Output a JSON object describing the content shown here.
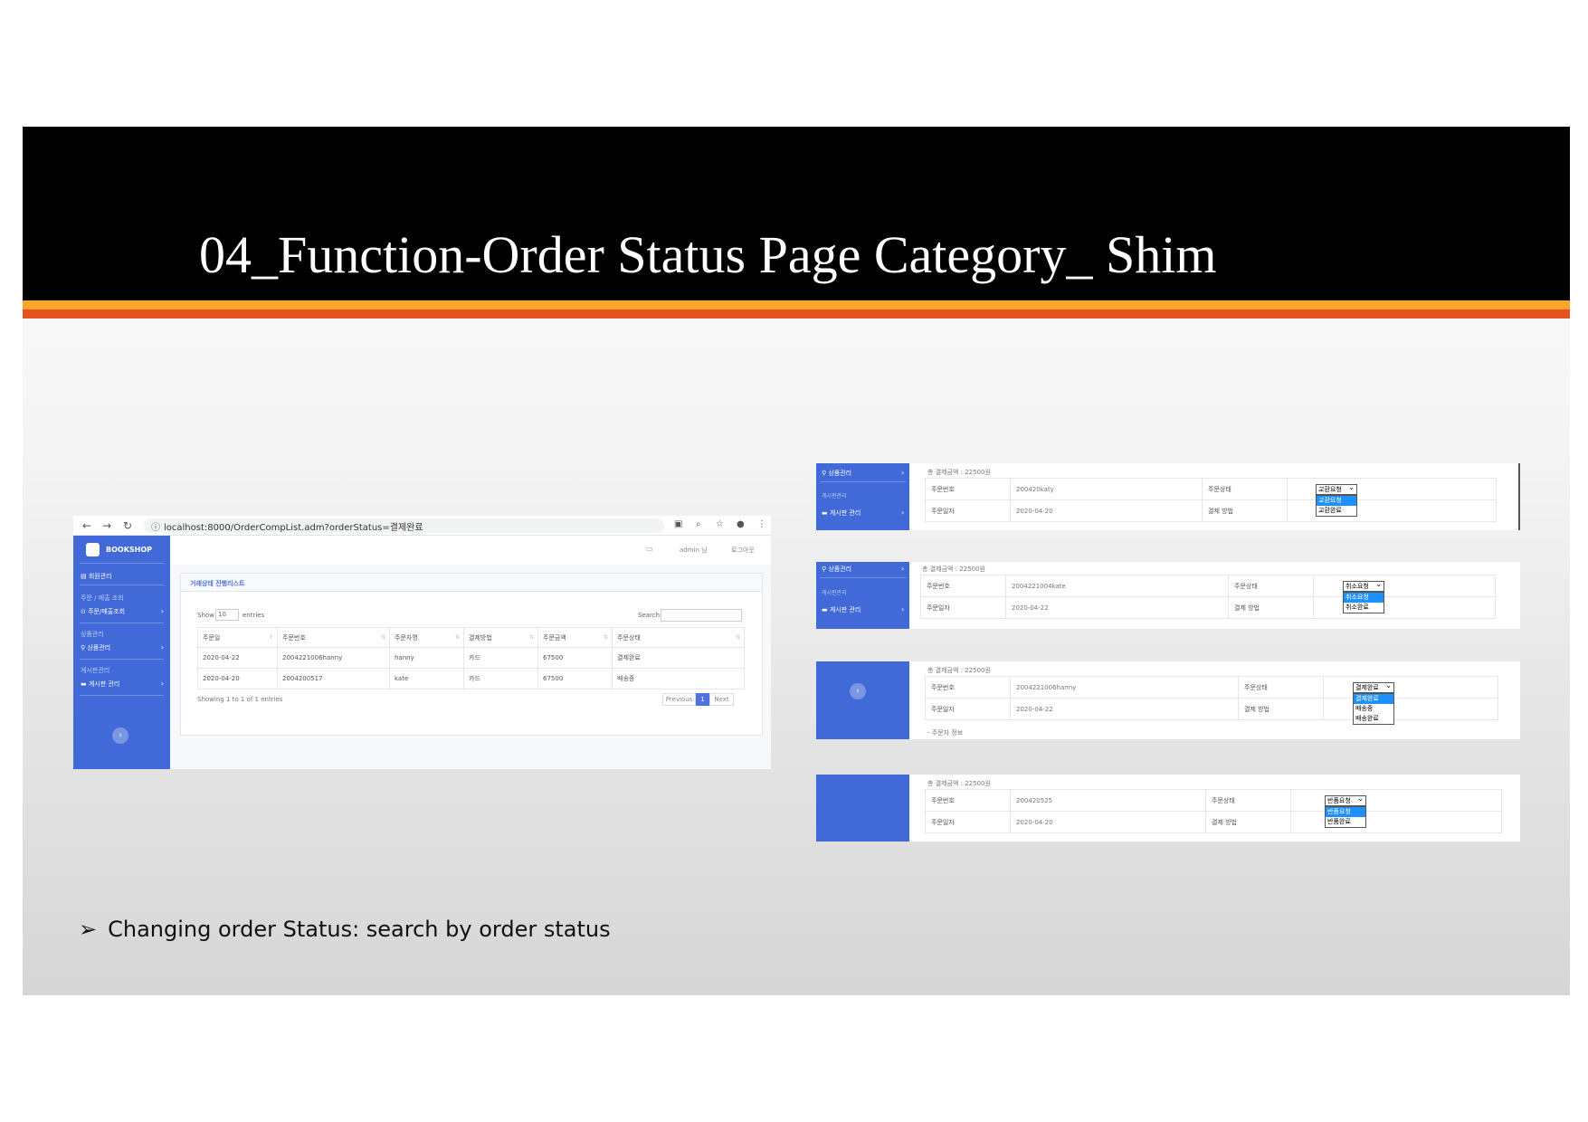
{
  "slide": {
    "title": "04_Function-Order Status Page Category_ Shim",
    "bullet": "Changing order Status: search by order status",
    "colors": {
      "header": "#000000",
      "stripe_yellow": "#f9a72b",
      "stripe_orange": "#e4521e",
      "sidebar": "#4169d8"
    }
  },
  "browser": {
    "url": "localhost:8000/OrderCompList.adm?orderStatus=결제완료"
  },
  "admin": {
    "brand": "BOOKSHOP",
    "sidebar": {
      "member": "회원관리",
      "sales_head": "주문 / 매출 조회",
      "order_item": "주문/매출조회",
      "product_head": "상품관리",
      "product_item": "상품관리",
      "board_head": "게시판관리",
      "board_item": "게시판 관리"
    },
    "topnav": {
      "user": "admin 님",
      "logout": "로그아웃"
    },
    "card_title": "거래상태 진행리스트",
    "show_label": "Show",
    "show_value": "10",
    "entries_label": "entries",
    "search_label": "Search:",
    "columns": [
      "주문일",
      "주문번호",
      "주문자명",
      "결제방법",
      "주문금액",
      "주문상태"
    ],
    "rows": [
      [
        "2020-04-22",
        "2004221006hanny",
        "hanny",
        "카드",
        "67500",
        "결제완료"
      ],
      [
        "2020-04-20",
        "2004200517",
        "kate",
        "카드",
        "67500",
        "배송중"
      ]
    ],
    "showing": "Showing 1 to 1 of 1 entries",
    "pager": {
      "prev": "Previous",
      "page": "1",
      "next": "Next"
    }
  },
  "snippets": [
    {
      "side": {
        "product": "상품관리",
        "board_head": "게시판관리",
        "board": "게시판 관리"
      },
      "total": "총 결제금액 : 22500원",
      "order_no_label": "주문번호",
      "order_no": "200420katy",
      "status_label": "주문상태",
      "date_label": "주문일자",
      "date": "2020-04-20",
      "pay_label": "결제 방법",
      "dropdown_value": "교환요청",
      "options": [
        "교환요청",
        "교환완료"
      ]
    },
    {
      "side": {
        "product": "상품관리",
        "board_head": "게시판관리",
        "board": "게시판 관리"
      },
      "total": "총 결제금액 : 22500원",
      "order_no_label": "주문번호",
      "order_no": "2004221004kate",
      "status_label": "주문상태",
      "date_label": "주문일자",
      "date": "2020-04-22",
      "pay_label": "결제 방법",
      "dropdown_value": "취소요청",
      "options": [
        "취소요청",
        "취소완료"
      ]
    },
    {
      "total": "총 결제금액 : 22500원",
      "order_no_label": "주문번호",
      "order_no": "2004221006hanny",
      "status_label": "주문상태",
      "date_label": "주문일자",
      "date": "2020-04-22",
      "pay_label": "결제 방법",
      "dropdown_value": "결제완료",
      "options": [
        "결제완료",
        "배송중",
        "배송완료"
      ],
      "extra": "- 주문자 정보"
    },
    {
      "total": "총 결제금액 : 22500원",
      "order_no_label": "주문번호",
      "order_no": "200420525",
      "status_label": "주문상태",
      "date_label": "주문일자",
      "date": "2020-04-20",
      "pay_label": "결제 방법",
      "dropdown_value": "반품요청",
      "options": [
        "반품요청",
        "반품완료"
      ]
    }
  ]
}
